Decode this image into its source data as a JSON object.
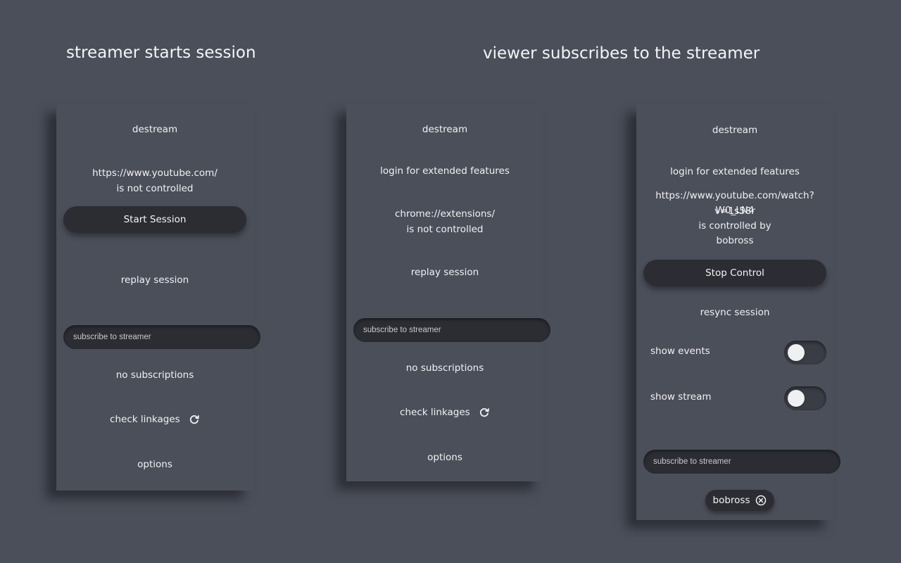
{
  "headings": {
    "left": "streamer starts session",
    "right": "viewer subscribes to the streamer"
  },
  "panel1": {
    "title": "destream",
    "url": "https://www.youtube.com/",
    "url_status": "is not controlled",
    "start_button": "Start Session",
    "replay_link": "replay session",
    "subscribe_placeholder": "subscribe to streamer",
    "subscriptions_status": "no subscriptions",
    "check_linkages": "check linkages",
    "options": "options"
  },
  "panel2": {
    "title": "destream",
    "login_link": "login for extended features",
    "url": "chrome://extensions/",
    "url_status": "is not controlled",
    "replay_link": "replay session",
    "subscribe_placeholder": "subscribe to streamer",
    "subscriptions_status": "no subscriptions",
    "check_linkages": "check linkages",
    "options": "options"
  },
  "panel3": {
    "title": "destream",
    "login_link": "login for extended features",
    "url_line1": "https://www.youtube.com/watch?v=1s58r",
    "url_line2": "W0_LN4",
    "url_status": "is controlled by",
    "controller": "bobross",
    "stop_button": "Stop Control",
    "resync_link": "resync session",
    "show_events_label": "show events",
    "show_events_on": false,
    "show_stream_label": "show stream",
    "show_stream_on": false,
    "subscribe_placeholder": "subscribe to streamer",
    "subscription_chip": "bobross"
  },
  "icons": {
    "refresh": "refresh-icon",
    "remove": "close-circle-icon"
  },
  "colors": {
    "background": "#4b4f5a",
    "control": "#2b2d33",
    "text": "#f1f2f4"
  }
}
